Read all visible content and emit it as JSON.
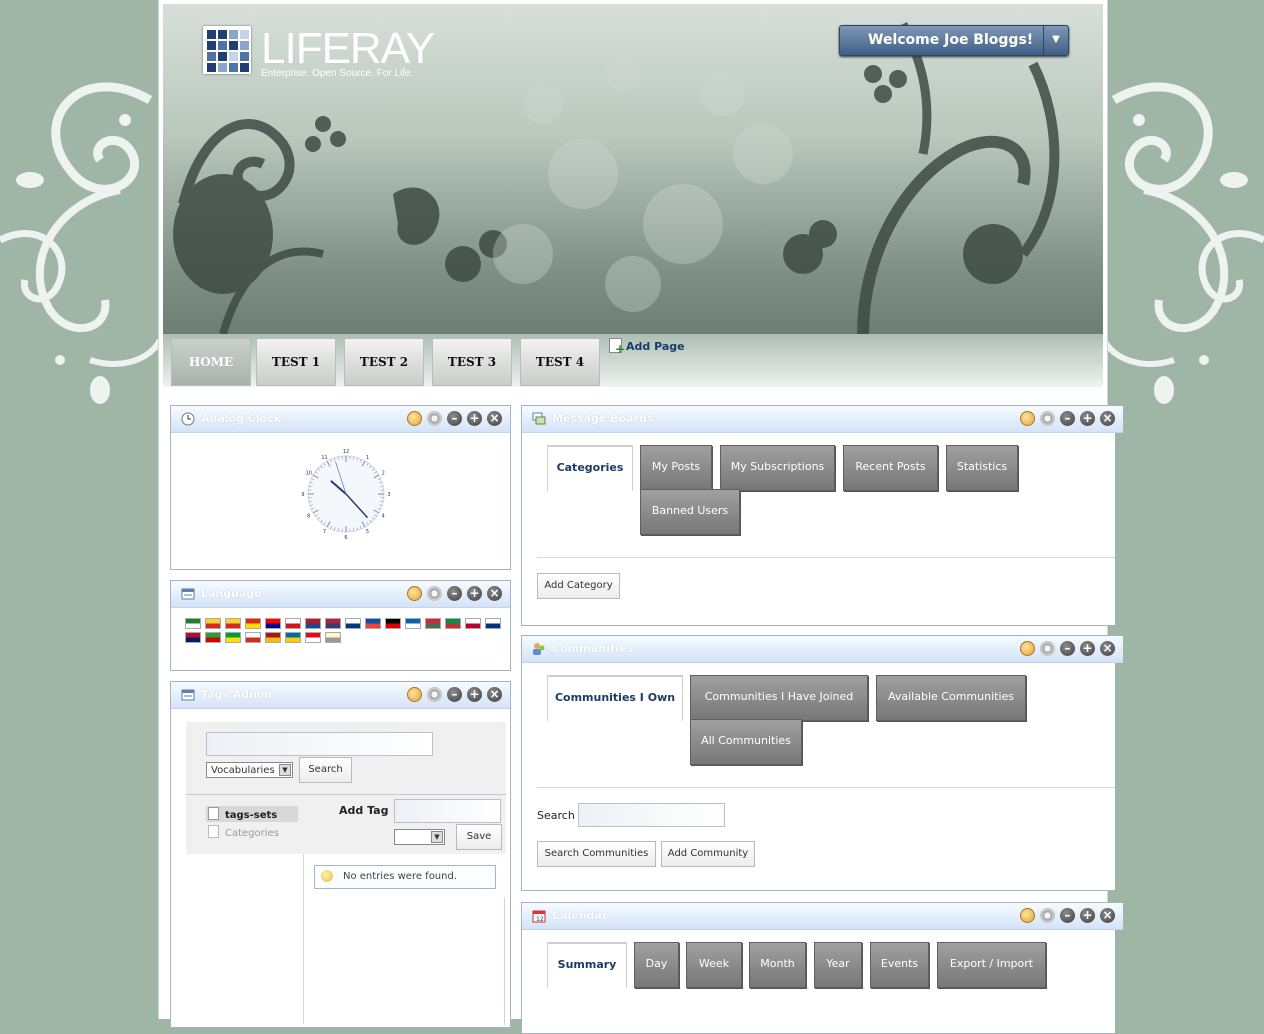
{
  "logo": {
    "name": "LIFERAY",
    "tagline": "Enterprise. Open Source. For Life."
  },
  "user_menu": {
    "label": "Welcome Joe Bloggs!",
    "icon": "dropdown-arrow-icon"
  },
  "navigation": {
    "tabs": [
      {
        "label": "HOME",
        "active": true
      },
      {
        "label": "TEST 1"
      },
      {
        "label": "TEST 2"
      },
      {
        "label": "TEST 3"
      },
      {
        "label": "TEST 4"
      }
    ],
    "add_page": "Add Page"
  },
  "portlets": {
    "clock": {
      "title": "Analog Clock",
      "time": {
        "hour": 10,
        "minute": 22,
        "second": 57
      }
    },
    "language": {
      "title": "Language",
      "flags": [
        "ar",
        "ca",
        "ca",
        "zh-cn",
        "zh-tw",
        "cs",
        "nl",
        "en",
        "fi",
        "fr",
        "de",
        "el",
        "hu",
        "it",
        "ja",
        "ko",
        "nb",
        "fa",
        "pt-br",
        "ru",
        "es",
        "sv",
        "tr",
        "vi"
      ]
    },
    "tags_admin": {
      "title": "Tags Admin",
      "search_input": "",
      "vocab_select": "Vocabularies",
      "search_button": "Search",
      "tree_items": [
        "tags-sets",
        "Categories"
      ],
      "add_tag_label": "Add Tag",
      "save_button": "Save",
      "empty_message": "No entries were found."
    },
    "message_boards": {
      "title": "Message Boards",
      "tabs": [
        "Categories",
        "My Posts",
        "My Subscriptions",
        "Recent Posts",
        "Statistics",
        "Banned Users"
      ],
      "add_category": "Add Category"
    },
    "communities": {
      "title": "Communities",
      "tabs": [
        "Communities I Own",
        "Communities I Have Joined",
        "Available Communities",
        "All Communities"
      ],
      "search_label": "Search",
      "search_button": "Search Communities",
      "add_button": "Add Community"
    },
    "calendar": {
      "title": "Calendar",
      "tabs": [
        "Summary",
        "Day",
        "Week",
        "Month",
        "Year",
        "Events",
        "Export / Import"
      ]
    }
  },
  "colors": {
    "background": "#9fb5a6",
    "portlet_title_bg": "#d3e3f7",
    "tab_gray": "#8a8a8a",
    "link_blue": "#163d6b"
  }
}
